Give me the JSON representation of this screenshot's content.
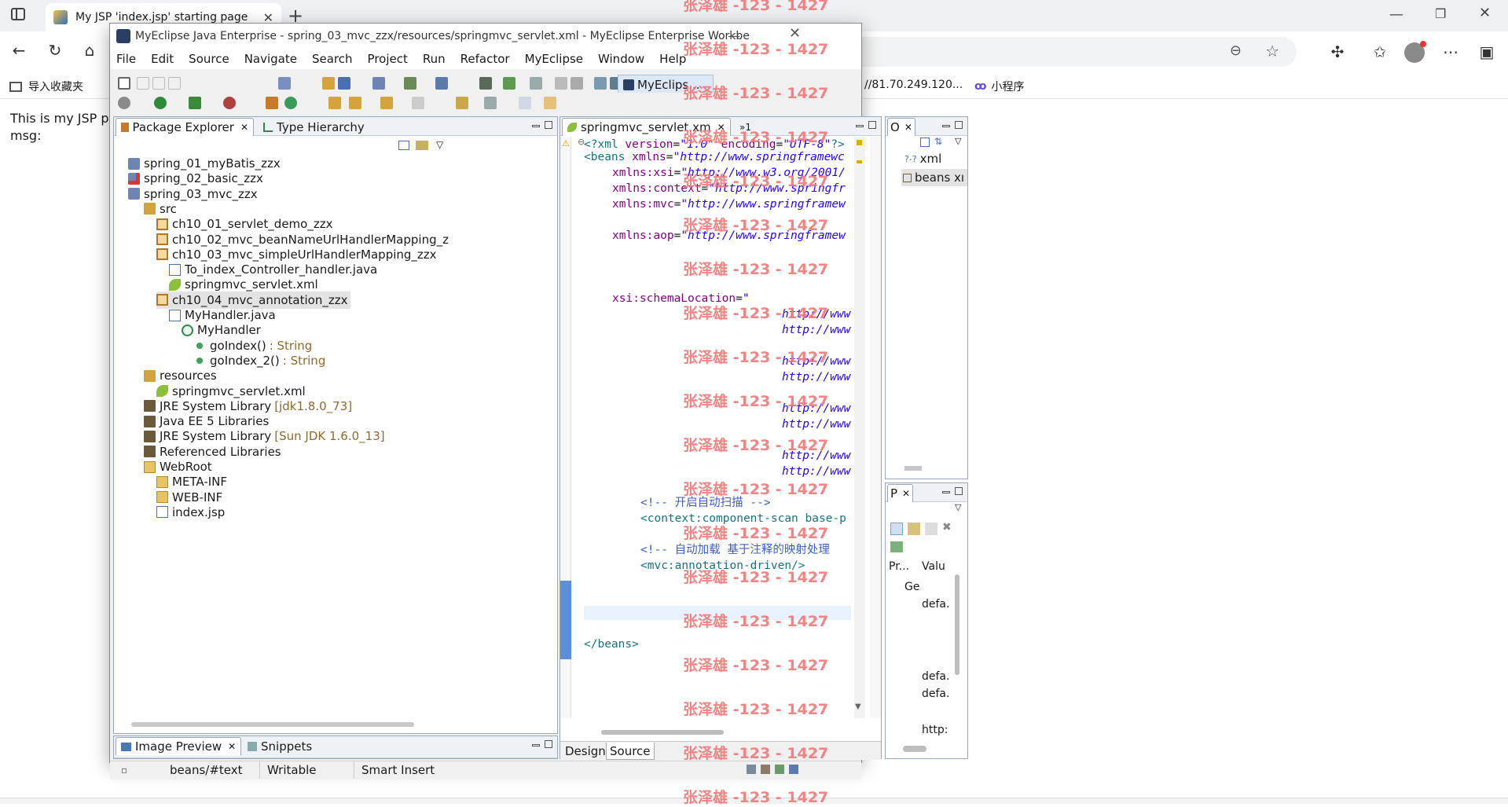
{
  "browser": {
    "tab_title": "My JSP 'index.jsp' starting page",
    "favorites": [
      {
        "label": "导入收藏夹"
      },
      {
        "label": "//81.70.249.120..."
      },
      {
        "label": "小程序"
      }
    ],
    "page_lines": [
      "This is my JSP pa",
      "msg:"
    ]
  },
  "eclipse": {
    "title": "MyEclipse Java Enterprise - spring_03_mvc_zzx/resources/springmvc_servlet.xml - MyEclipse Enterprise Workbe",
    "menu": [
      "File",
      "Edit",
      "Source",
      "Navigate",
      "Search",
      "Project",
      "Run",
      "Refactor",
      "MyEclipse",
      "Window",
      "Help"
    ],
    "perspective": "MyEclips...",
    "package_explorer": {
      "tab": "Package Explorer",
      "tab2": "Type Hierarchy",
      "tree": [
        {
          "label": "spring_01_myBatis_zzx",
          "depth": 0,
          "icon": "project"
        },
        {
          "label": "spring_02_basic_zzx",
          "depth": 0,
          "icon": "project-err"
        },
        {
          "label": "spring_03_mvc_zzx",
          "depth": 0,
          "icon": "project"
        },
        {
          "label": "src",
          "depth": 1,
          "icon": "srcfolder"
        },
        {
          "label": "ch10_01_servlet_demo_zzx",
          "depth": 2,
          "icon": "package"
        },
        {
          "label": "ch10_02_mvc_beanNameUrlHandlerMapping_z",
          "depth": 2,
          "icon": "package"
        },
        {
          "label": "ch10_03_mvc_simpleUrlHandlerMapping_zzx",
          "depth": 2,
          "icon": "package"
        },
        {
          "label": "To_index_Controller_handler.java",
          "depth": 3,
          "icon": "java"
        },
        {
          "label": "springmvc_servlet.xml",
          "depth": 3,
          "icon": "leaf"
        },
        {
          "label": "ch10_04_mvc_annotation_zzx",
          "depth": 2,
          "icon": "package",
          "selected": true
        },
        {
          "label": "MyHandler.java",
          "depth": 3,
          "icon": "java"
        },
        {
          "label": "MyHandler",
          "depth": 4,
          "icon": "class"
        },
        {
          "label": "goIndex()",
          "depth": 5,
          "icon": "method",
          "suffix": ": String"
        },
        {
          "label": "goIndex_2()",
          "depth": 5,
          "icon": "method",
          "suffix": ": String"
        },
        {
          "label": "resources",
          "depth": 1,
          "icon": "srcfolder"
        },
        {
          "label": "springmvc_servlet.xml",
          "depth": 2,
          "icon": "leaf"
        },
        {
          "label": "JRE System Library",
          "depth": 1,
          "icon": "lib",
          "suffix": "[jdk1.8.0_73]"
        },
        {
          "label": "Java EE 5 Libraries",
          "depth": 1,
          "icon": "lib"
        },
        {
          "label": "JRE System Library",
          "depth": 1,
          "icon": "lib",
          "suffix": "[Sun JDK 1.6.0_13]"
        },
        {
          "label": "Referenced Libraries",
          "depth": 1,
          "icon": "lib"
        },
        {
          "label": "WebRoot",
          "depth": 1,
          "icon": "folder"
        },
        {
          "label": "META-INF",
          "depth": 2,
          "icon": "folder"
        },
        {
          "label": "WEB-INF",
          "depth": 2,
          "icon": "folder"
        },
        {
          "label": "index.jsp",
          "depth": 2,
          "icon": "jsp"
        }
      ]
    },
    "editor": {
      "tab": "springmvc_servlet.xm",
      "overflow": "»1",
      "bottom_tabs": [
        "Design",
        "Source"
      ]
    },
    "outline": {
      "tab": "O",
      "items": [
        {
          "label": "xml",
          "icon": "xmldecl"
        },
        {
          "label": "beans xı",
          "icon": "element"
        }
      ]
    },
    "properties": {
      "tab": "P",
      "col1": "Pr...",
      "col2": "Valu",
      "rows": [
        "Ge",
        "defa.",
        "defa.",
        "defa.",
        "http:"
      ]
    },
    "bottom_view": {
      "tab1": "Image Preview",
      "tab2": "Snippets"
    },
    "status": {
      "path": "beans/#text",
      "mode": "Writable",
      "insert": "Smart Insert"
    }
  },
  "watermark": "张泽雄 -123 - 1427"
}
